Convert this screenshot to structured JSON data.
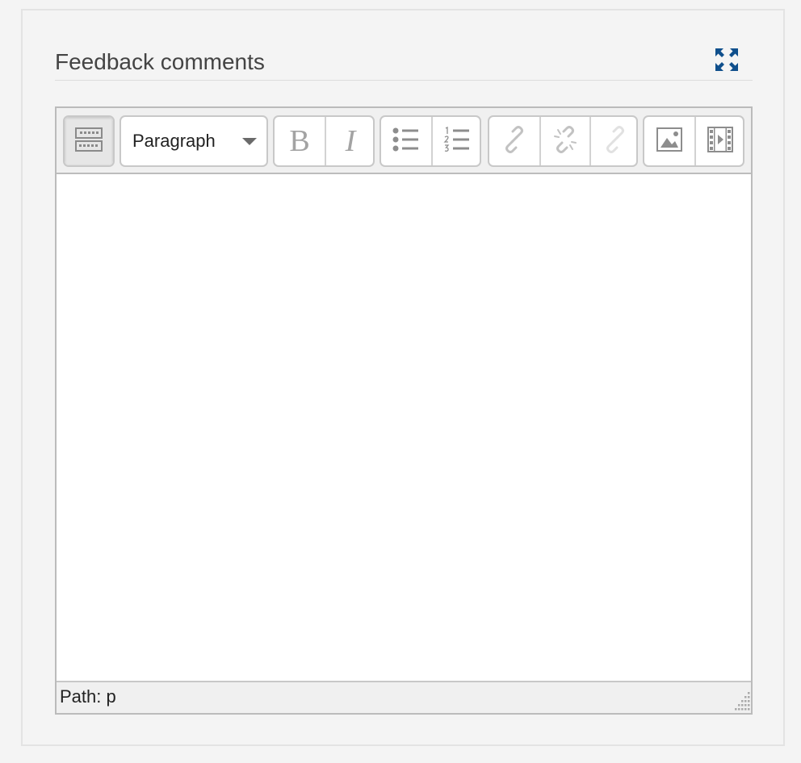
{
  "section": {
    "heading": "Feedback comments",
    "expand_icon": "expand-arrows-icon",
    "accent": "#0f4f8c"
  },
  "toolbar": {
    "toggle_icon": "keyboard-toggle-icon",
    "format_select": {
      "selected": "Paragraph"
    },
    "bold_label": "B",
    "italic_label": "I",
    "buttons": [
      {
        "name": "toolbar-toggle-button",
        "icon": "keyboard-toggle-icon"
      },
      {
        "name": "bold-button",
        "icon": "bold-icon"
      },
      {
        "name": "italic-button",
        "icon": "italic-icon"
      },
      {
        "name": "bullet-list-button",
        "icon": "bullet-list-icon"
      },
      {
        "name": "numbered-list-button",
        "icon": "numbered-list-icon"
      },
      {
        "name": "link-button",
        "icon": "link-icon"
      },
      {
        "name": "unlink-button",
        "icon": "unlink-icon"
      },
      {
        "name": "anchor-button",
        "icon": "anchor-link-icon"
      },
      {
        "name": "image-button",
        "icon": "image-icon"
      },
      {
        "name": "media-button",
        "icon": "film-icon"
      }
    ]
  },
  "editor": {
    "content": ""
  },
  "statusbar": {
    "path": "Path: p",
    "resize_icon": "resize-grip-icon"
  }
}
